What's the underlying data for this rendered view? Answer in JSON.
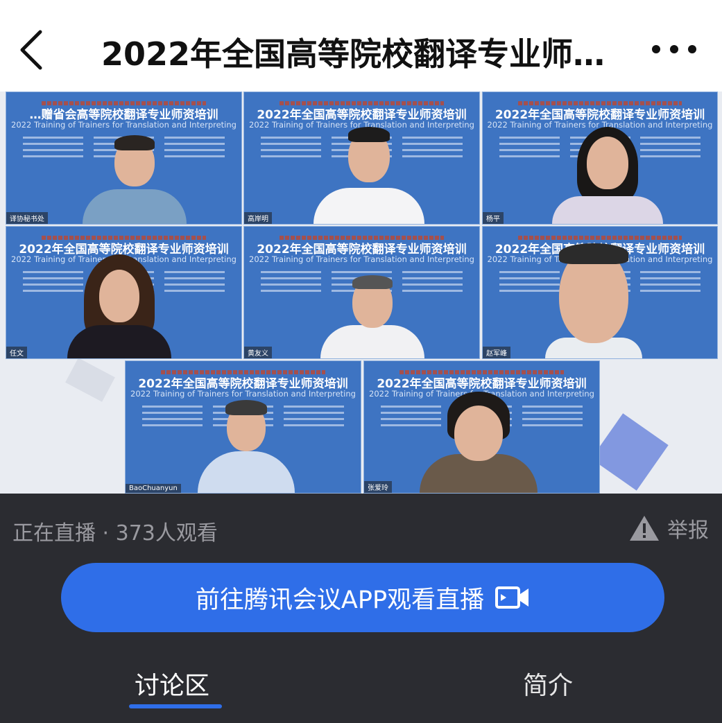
{
  "header": {
    "title": "2022年全国高等院校翻译专业师…",
    "back_icon": "chevron-left-icon",
    "more_icon": "more-horizontal-icon"
  },
  "slide": {
    "title_cn": "2022年全国高等院校翻译专业师资培训",
    "title_en": "2022 Training of Trainers for Translation and Interpreting"
  },
  "participants": [
    {
      "name": "译协秘书处",
      "title_cn": "…赠省会高等院校翻译专业师资培训"
    },
    {
      "name": "高岸明"
    },
    {
      "name": "杨平"
    },
    {
      "name": "任文"
    },
    {
      "name": "黄友义"
    },
    {
      "name": "赵军峰"
    },
    {
      "name": "BaoChuanyun"
    },
    {
      "name": "张爱玲"
    }
  ],
  "status": {
    "live_text": "正在直播 · 373人观看",
    "report_label": "举报",
    "report_icon": "warning-icon"
  },
  "app_button": {
    "label": "前往腾讯会议APP观看直播",
    "icon": "video-camera-icon"
  },
  "tabs": [
    {
      "label": "讨论区",
      "active": true
    },
    {
      "label": "简介",
      "active": false
    }
  ],
  "colors": {
    "accent": "#2f6ee8",
    "slide_bg": "#3e74c2",
    "dark_bg": "#2b2c31"
  }
}
